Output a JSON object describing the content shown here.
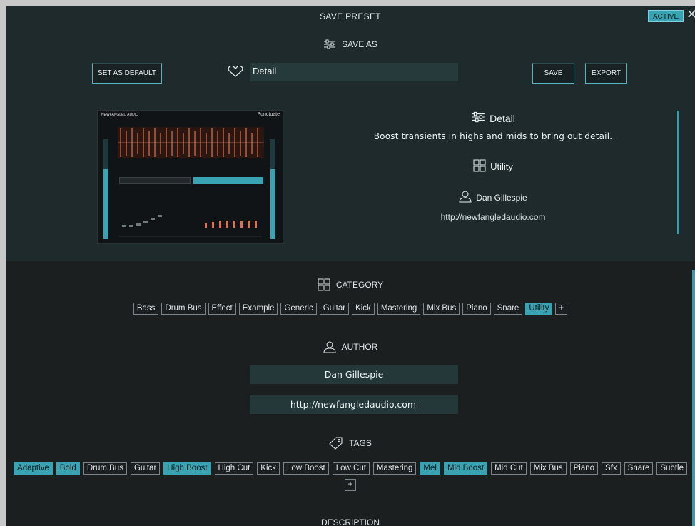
{
  "header": {
    "title": "SAVE PRESET",
    "active_label": "ACTIVE",
    "close_glyph": "✕"
  },
  "save_as": {
    "heading": "SAVE AS",
    "set_default_label": "SET AS DEFAULT",
    "name_value": "Detail",
    "save_label": "SAVE",
    "export_label": "EXPORT"
  },
  "preview": {
    "brand": "NEWFANGLED AUDIO",
    "product": "Punctuate"
  },
  "info": {
    "name": "Detail",
    "description": "Boost transients in highs and mids to bring out detail.",
    "category": "Utility",
    "author": "Dan Gillespie",
    "url": "http://newfangledaudio.com"
  },
  "category": {
    "heading": "CATEGORY",
    "items": [
      {
        "label": "Bass",
        "selected": false
      },
      {
        "label": "Drum Bus",
        "selected": false
      },
      {
        "label": "Effect",
        "selected": false
      },
      {
        "label": "Example",
        "selected": false
      },
      {
        "label": "Generic",
        "selected": false
      },
      {
        "label": "Guitar",
        "selected": false
      },
      {
        "label": "Kick",
        "selected": false
      },
      {
        "label": "Mastering",
        "selected": false
      },
      {
        "label": "Mix Bus",
        "selected": false
      },
      {
        "label": "Piano",
        "selected": false
      },
      {
        "label": "Snare",
        "selected": false
      },
      {
        "label": "Utility",
        "selected": true
      },
      {
        "label": "+",
        "selected": false
      }
    ]
  },
  "author": {
    "heading": "AUTHOR",
    "name_value": "Dan Gillespie",
    "url_value": "http://newfangledaudio.com"
  },
  "tags": {
    "heading": "TAGS",
    "items": [
      {
        "label": "Adaptive",
        "selected": true
      },
      {
        "label": "Bold",
        "selected": true
      },
      {
        "label": "Drum Bus",
        "selected": false
      },
      {
        "label": "Guitar",
        "selected": false
      },
      {
        "label": "High Boost",
        "selected": true
      },
      {
        "label": "High Cut",
        "selected": false
      },
      {
        "label": "Kick",
        "selected": false
      },
      {
        "label": "Low Boost",
        "selected": false
      },
      {
        "label": "Low Cut",
        "selected": false
      },
      {
        "label": "Mastering",
        "selected": false
      },
      {
        "label": "Mel",
        "selected": true
      },
      {
        "label": "Mid Boost",
        "selected": true
      },
      {
        "label": "Mid Cut",
        "selected": false
      },
      {
        "label": "Mix Bus",
        "selected": false
      },
      {
        "label": "Piano",
        "selected": false
      },
      {
        "label": "Sfx",
        "selected": false
      },
      {
        "label": "Snare",
        "selected": false
      },
      {
        "label": "Subtle",
        "selected": false
      }
    ],
    "add_label": "+"
  },
  "description": {
    "heading": "DESCRIPTION"
  },
  "colors": {
    "accent": "#3aa3b3",
    "panel_top": "#1e2a2b",
    "panel_bottom": "#1c1f20"
  }
}
